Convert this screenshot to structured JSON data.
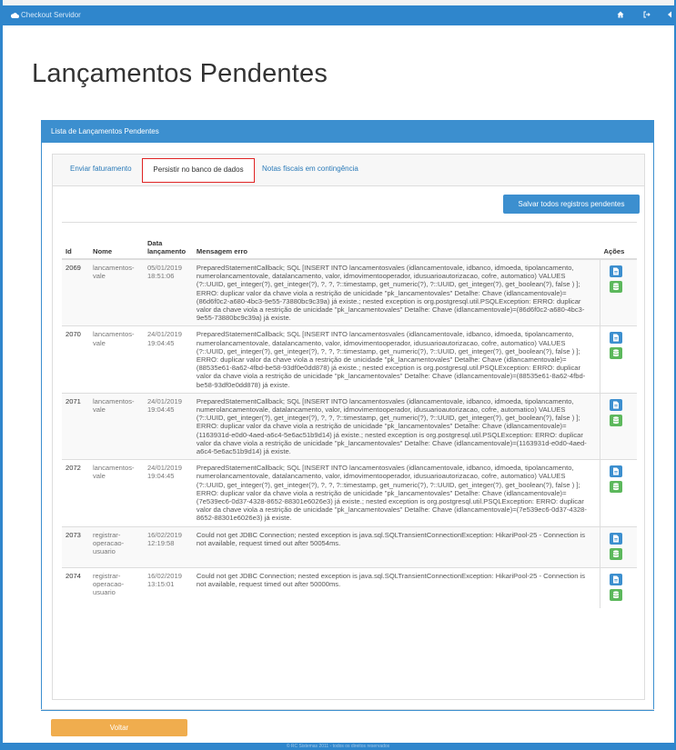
{
  "navbar": {
    "brand": "Checkout Servidor",
    "home_icon": "home-icon",
    "logout_icon": "sign-out-icon"
  },
  "page_title": "Lançamentos Pendentes",
  "panel": {
    "heading": "Lista de Lançamentos Pendentes"
  },
  "tabs": [
    {
      "label": "Enviar faturamento",
      "active": false
    },
    {
      "label": "Persistir no banco de dados",
      "active": true
    },
    {
      "label": "Notas fiscais em contingência",
      "active": false
    }
  ],
  "save_all_label": "Salvar todos registros pendentes",
  "table": {
    "headers": {
      "id": "Id",
      "name": "Nome",
      "date_line1": "Data",
      "date_line2": "lançamento",
      "message": "Mensagem erro",
      "actions": "Ações"
    },
    "rows": [
      {
        "id": "2069",
        "name": "lancamentos-vale",
        "date": "05/01/2019",
        "time": "18:51:06",
        "message": "PreparedStatementCallback; SQL [INSERT INTO lancamentosvales (idlancamentovale, idbanco, idmoeda, tipolancamento, numerolancamentovale, datalancamento, valor, idmovimentooperador, idusuarioautorizacao, cofre, automatico) VALUES (?::UUID, get_integer(?), get_integer(?), ?, ?, ?::timestamp, get_numeric(?), ?::UUID, get_integer(?), get_boolean(?), false ) ]; ERRO: duplicar valor da chave viola a restrição de unicidade \"pk_lancamentovales\" Detalhe: Chave (idlancamentovale)=(86d6f0c2-a680-4bc3-9e55-73880bc9c39a) já existe.; nested exception is org.postgresql.util.PSQLException: ERRO: duplicar valor da chave viola a restrição de unicidade \"pk_lancamentovales\" Detalhe: Chave (idlancamentovale)=(86d6f0c2-a680-4bc3-9e55-73880bc9c39a) já existe."
      },
      {
        "id": "2070",
        "name": "lancamentos-vale",
        "date": "24/01/2019",
        "time": "19:04:45",
        "message": "PreparedStatementCallback; SQL [INSERT INTO lancamentosvales (idlancamentovale, idbanco, idmoeda, tipolancamento, numerolancamentovale, datalancamento, valor, idmovimentooperador, idusuarioautorizacao, cofre, automatico) VALUES (?::UUID, get_integer(?), get_integer(?), ?, ?, ?::timestamp, get_numeric(?), ?::UUID, get_integer(?), get_boolean(?), false ) ]; ERRO: duplicar valor da chave viola a restrição de unicidade \"pk_lancamentovales\" Detalhe: Chave (idlancamentovale)=(88535e61-8a62-4fbd-be58-93df0e0dd878) já existe.; nested exception is org.postgresql.util.PSQLException: ERRO: duplicar valor da chave viola a restrição de unicidade \"pk_lancamentovales\" Detalhe: Chave (idlancamentovale)=(88535e61-8a62-4fbd-be58-93df0e0dd878) já existe."
      },
      {
        "id": "2071",
        "name": "lancamentos-vale",
        "date": "24/01/2019",
        "time": "19:04:45",
        "message": "PreparedStatementCallback; SQL [INSERT INTO lancamentosvales (idlancamentovale, idbanco, idmoeda, tipolancamento, numerolancamentovale, datalancamento, valor, idmovimentooperador, idusuarioautorizacao, cofre, automatico) VALUES (?::UUID, get_integer(?), get_integer(?), ?, ?, ?::timestamp, get_numeric(?), ?::UUID, get_integer(?), get_boolean(?), false ) ]; ERRO: duplicar valor da chave viola a restrição de unicidade \"pk_lancamentovales\" Detalhe: Chave (idlancamentovale)=(1163931d-e0d0-4aed-a6c4-5e6ac51b9d14) já existe.; nested exception is org.postgresql.util.PSQLException: ERRO: duplicar valor da chave viola a restrição de unicidade \"pk_lancamentovales\" Detalhe: Chave (idlancamentovale)=(1163931d-e0d0-4aed-a6c4-5e6ac51b9d14) já existe."
      },
      {
        "id": "2072",
        "name": "lancamentos-vale",
        "date": "24/01/2019",
        "time": "19:04:45",
        "message": "PreparedStatementCallback; SQL [INSERT INTO lancamentosvales (idlancamentovale, idbanco, idmoeda, tipolancamento, numerolancamentovale, datalancamento, valor, idmovimentooperador, idusuarioautorizacao, cofre, automatico) VALUES (?::UUID, get_integer(?), get_integer(?), ?, ?, ?::timestamp, get_numeric(?), ?::UUID, get_integer(?), get_boolean(?), false ) ]; ERRO: duplicar valor da chave viola a restrição de unicidade \"pk_lancamentovales\" Detalhe: Chave (idlancamentovale)=(7e539ec6-0d37-4328-8652-88301e6026e3) já existe.; nested exception is org.postgresql.util.PSQLException: ERRO: duplicar valor da chave viola a restrição de unicidade \"pk_lancamentovales\" Detalhe: Chave (idlancamentovale)=(7e539ec6-0d37-4328-8652-88301e6026e3) já existe."
      },
      {
        "id": "2073",
        "name": "registrar-operacao-usuario",
        "date": "16/02/2019",
        "time": "12:19:58",
        "message": "Could not get JDBC Connection; nested exception is java.sql.SQLTransientConnectionException: HikariPool-25 - Connection is not available, request timed out after 50054ms."
      },
      {
        "id": "2074",
        "name": "registrar-operacao-usuario",
        "date": "16/02/2019",
        "time": "13:15:01",
        "message": "Could not get JDBC Connection; nested exception is java.sql.SQLTransientConnectionException: HikariPool-25 - Connection is not available, request timed out after 50000ms."
      }
    ]
  },
  "row_action_icons": {
    "details": "document-icon",
    "persist": "database-icon"
  },
  "back_label": "Voltar",
  "footer_text": "© RC Sistemas 2011 - todos os direitos reservados",
  "colors": {
    "primary": "#3c8fcf",
    "success": "#5cb85c",
    "warning": "#f0ad4e",
    "highlight_border": "#e02424"
  }
}
